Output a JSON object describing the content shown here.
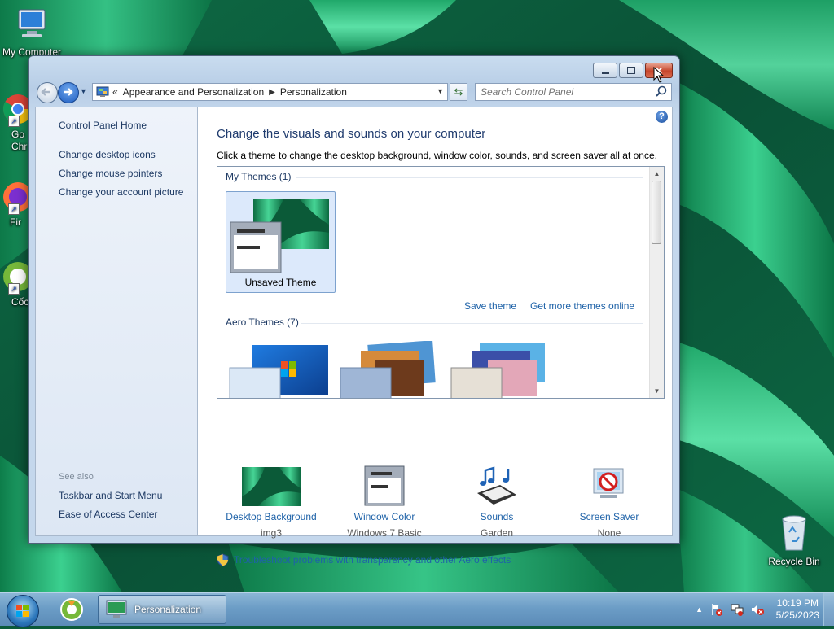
{
  "desktop": {
    "icons": [
      {
        "label": "My Computer"
      },
      {
        "label": "Go\nChr"
      },
      {
        "label": "Fir"
      },
      {
        "label": "Cốc"
      },
      {
        "label": "Recycle Bin"
      }
    ]
  },
  "window": {
    "address": {
      "root_glyph": "«",
      "crumbs": [
        "Appearance and Personalization",
        "Personalization"
      ]
    },
    "search": {
      "placeholder": "Search Control Panel"
    },
    "left_pane": {
      "home": "Control Panel Home",
      "tasks": [
        "Change desktop icons",
        "Change mouse pointers",
        "Change your account picture"
      ],
      "see_also_title": "See also",
      "see_also": [
        "Taskbar and Start Menu",
        "Ease of Access Center"
      ]
    },
    "main": {
      "title": "Change the visuals and sounds on your computer",
      "subtitle": "Click a theme to change the desktop background, window color, sounds, and screen saver all at once.",
      "my_themes_title": "My Themes (1)",
      "unsaved_theme": "Unsaved Theme",
      "save_theme": "Save theme",
      "more_themes": "Get more themes online",
      "aero_themes_title": "Aero Themes (7)",
      "bottom": [
        {
          "label": "Desktop Background",
          "value": "img3"
        },
        {
          "label": "Window Color",
          "value": "Windows 7 Basic"
        },
        {
          "label": "Sounds",
          "value": "Garden"
        },
        {
          "label": "Screen Saver",
          "value": "None"
        }
      ],
      "troubleshoot": "Troubleshoot problems with transparency and other Aero effects"
    }
  },
  "taskbar": {
    "task_label": "Personalization",
    "time": "10:19 PM",
    "date": "5/25/2023"
  },
  "colors": {
    "link": "#1e62a8",
    "heading": "#1f3b6e",
    "close_button": "#c6452b"
  }
}
